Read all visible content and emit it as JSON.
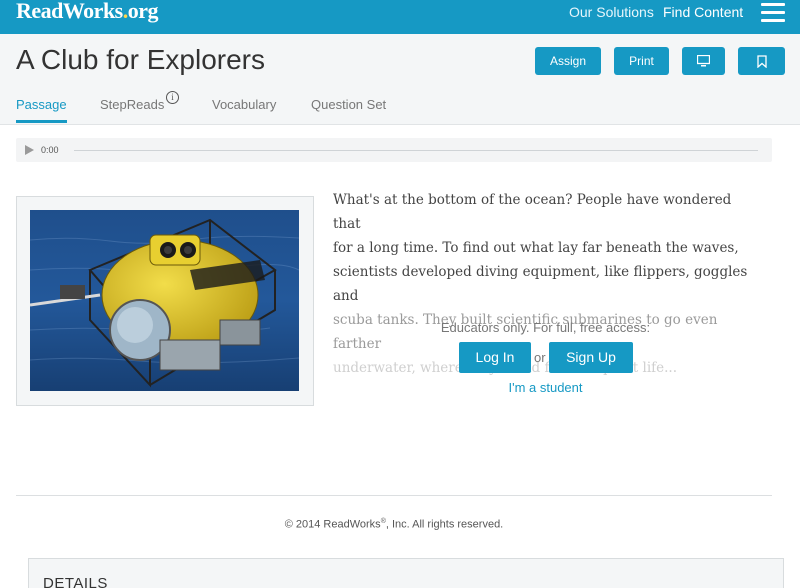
{
  "brand": {
    "logo_main": "ReadWorks",
    "logo_dot": ".",
    "logo_suffix": "org",
    "accent_color": "#1699c4",
    "dot_color": "#ffd54a"
  },
  "nav": {
    "solutions": "Our Solutions",
    "find_content": "Find Content",
    "menu_icon": "hamburger-menu-icon"
  },
  "header": {
    "title": "A Club for Explorers",
    "buttons": {
      "assign": "Assign",
      "print": "Print",
      "present_icon": "monitor-icon",
      "bookmark_icon": "bookmark-icon"
    },
    "tabs": {
      "passage": "Passage",
      "stepreads": "StepReads",
      "stepreads_info": "i",
      "vocabulary": "Vocabulary",
      "question_set": "Question Set"
    }
  },
  "audio": {
    "time": "0:00",
    "play_icon": "play-icon",
    "progress": 0
  },
  "passage": {
    "line1": "What's at the bottom of the ocean? People have wondered that",
    "line2": "for a long time. To find out what lay far beneath the waves,",
    "line3": "scientists developed diving equipment, like flippers, goggles and",
    "line4": "scuba tanks. They built scientific submarines to go even farther",
    "line5": "underwater, where they found fish and plant life..."
  },
  "access": {
    "educators_text": "Educators only. For full, free access:",
    "login": "Log In",
    "or": "or",
    "signup": "Sign Up",
    "student": "I'm a student"
  },
  "footer": {
    "copyright_pre": "© 2014 ReadWorks",
    "copyright_reg": "®",
    "copyright_post": ", Inc. All rights reserved."
  },
  "details": {
    "title": "DETAILS"
  }
}
